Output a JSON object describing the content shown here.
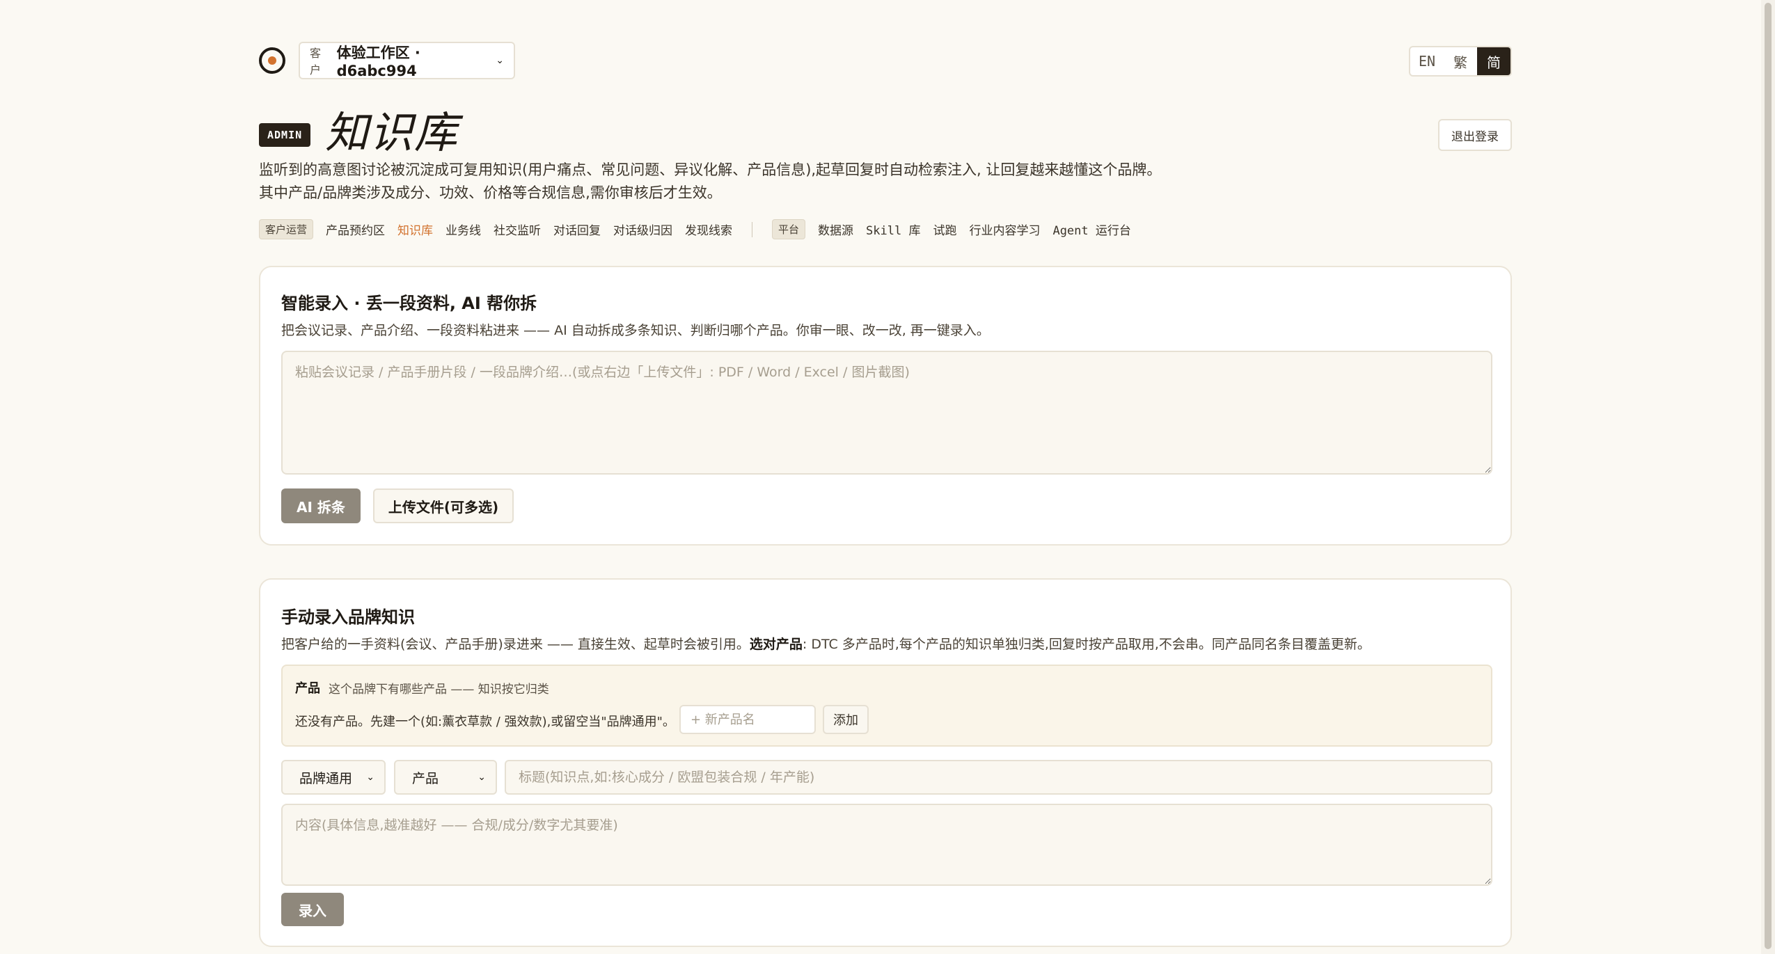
{
  "header": {
    "workspace_label": "客户",
    "workspace_value": "体验工作区 · d6abc994",
    "languages": [
      "EN",
      "繁",
      "简"
    ],
    "active_language": "简",
    "logout_label": "退出登录"
  },
  "title": {
    "badge": "ADMIN",
    "text": "知识库",
    "description": "监听到的高意图讨论被沉淀成可复用知识(用户痛点、常见问题、异议化解、产品信息),起草回复时自动检索注入, 让回复越来越懂这个品牌。其中产品/品牌类涉及成分、功效、价格等合规信息,需你审核后才生效。"
  },
  "nav": {
    "group1_tag": "客户运营",
    "group1_items": [
      "产品预约区",
      "知识库",
      "业务线",
      "社交监听",
      "对话回复",
      "对话级归因",
      "发现线索"
    ],
    "active_item": "知识库",
    "group2_tag": "平台",
    "group2_items": [
      "数据源",
      "Skill 库",
      "试跑",
      "行业内容学习",
      "Agent 运行台"
    ]
  },
  "smart_entry": {
    "title": "智能录入 · 丢一段资料, AI 帮你拆",
    "subtitle": "把会议记录、产品介绍、一段资料粘进来 —— AI 自动拆成多条知识、判断归哪个产品。你审一眼、改一改, 再一键录入。",
    "placeholder": "粘贴会议记录 / 产品手册片段 / 一段品牌介绍…(或点右边「上传文件」: PDF / Word / Excel / 图片截图)",
    "ai_button": "AI 拆条",
    "upload_button": "上传文件(可多选)"
  },
  "manual_entry": {
    "title": "手动录入品牌知识",
    "subtitle_pre": "把客户给的一手资料(会议、产品手册)录进来 —— 直接生效、起草时会被引用。",
    "subtitle_bold": "选对产品",
    "subtitle_post": ": DTC 多产品时,每个产品的知识单独归类,回复时按产品取用,不会串。同产品同名条目覆盖更新。",
    "products_label": "产品",
    "products_hint": "这个品牌下有哪些产品 —— 知识按它归类",
    "products_empty": "还没有产品。先建一个(如:薰衣草款 / 强效款),或留空当\"品牌通用\"。",
    "new_product_placeholder": "+ 新产品名",
    "add_button": "添加",
    "scope_select": "品牌通用",
    "type_select": "产品",
    "title_placeholder": "标题(知识点,如:核心成分 / 欧盟包装合规 / 年产能)",
    "content_placeholder": "内容(具体信息,越准越好 —— 合规/成分/数字尤其要准)",
    "submit_button": "录入"
  },
  "colors": {
    "accent": "#d2722e",
    "dark": "#2a2219",
    "background": "#fbf9f3"
  }
}
